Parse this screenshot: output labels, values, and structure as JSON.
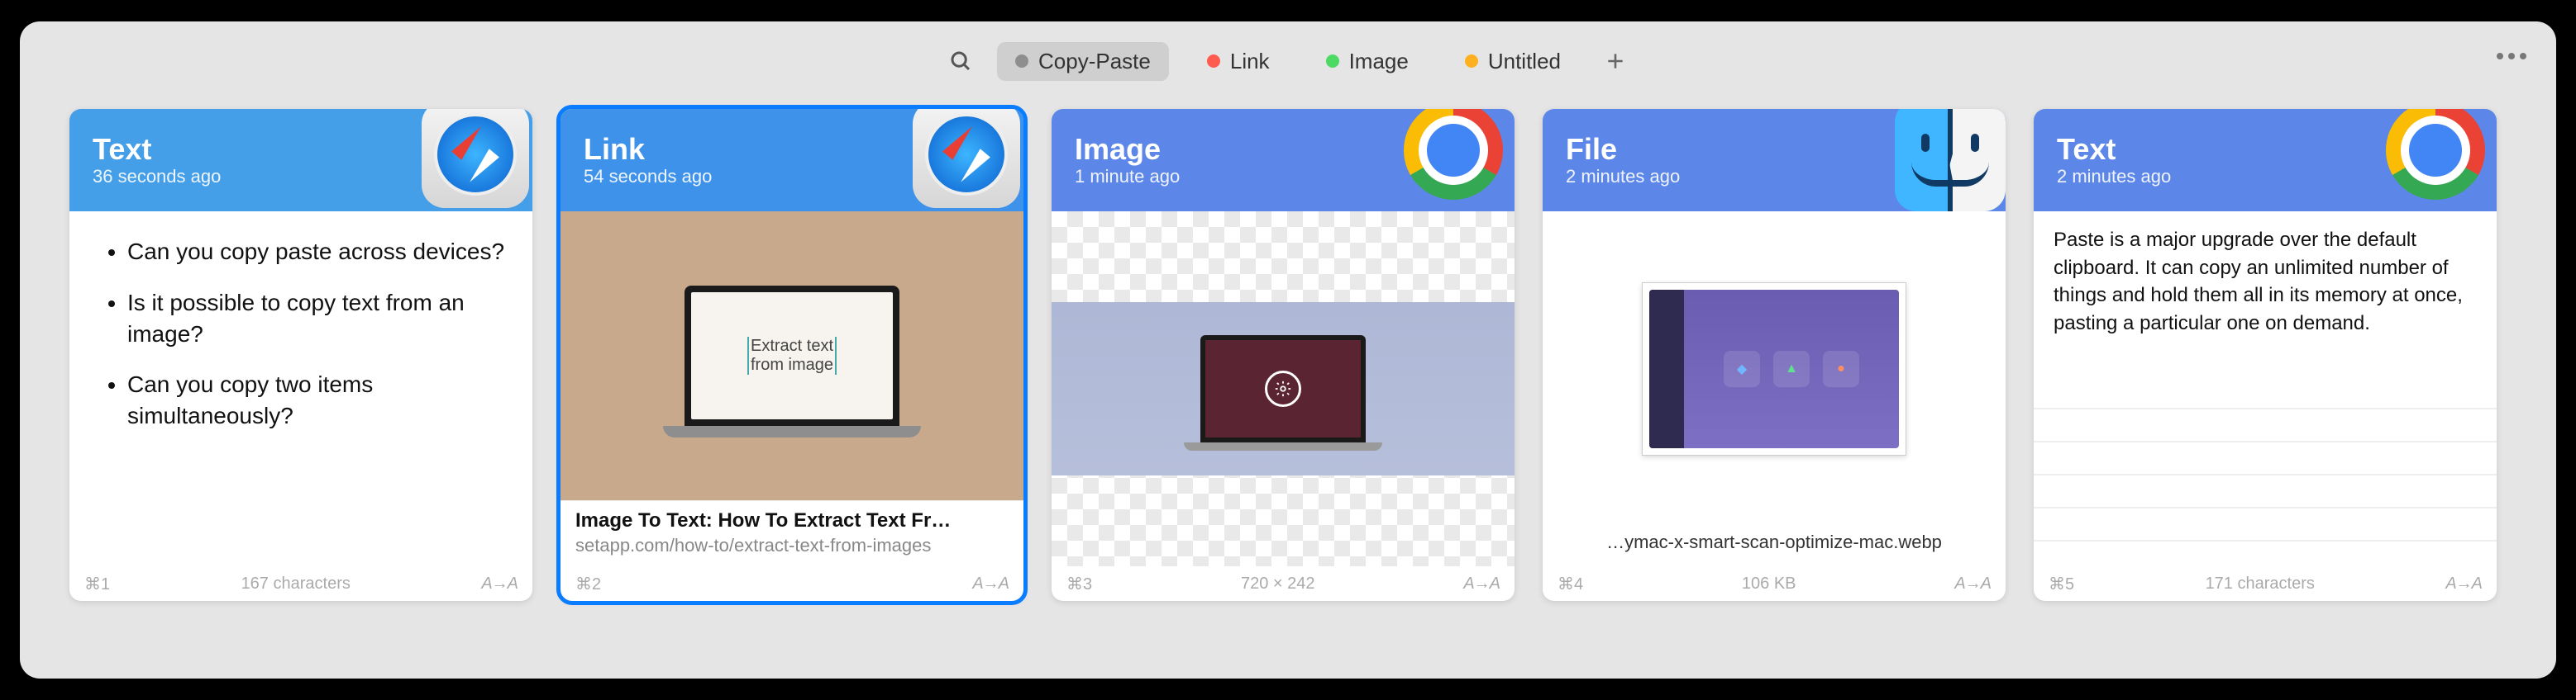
{
  "toolbar": {
    "tags": [
      {
        "label": "Copy-Paste",
        "dot": "#8e8e8e",
        "active": true
      },
      {
        "label": "Link",
        "dot": "#ff5b51",
        "active": false
      },
      {
        "label": "Image",
        "dot": "#4cd964",
        "active": false
      },
      {
        "label": "Untitled",
        "dot": "#ffb020",
        "active": false
      }
    ]
  },
  "transform_label": "A→A",
  "cards": [
    {
      "type": "Text",
      "time": "36 seconds ago",
      "shortcut": "⌘1",
      "meta": "167 characters",
      "bullets": [
        "Can you copy paste across devices?",
        "Is it possible to copy text from an image?",
        "Can you copy two items simultaneously?"
      ]
    },
    {
      "type": "Link",
      "time": "54 seconds ago",
      "shortcut": "⌘2",
      "meta": "",
      "preview_text_1": "Extract text",
      "preview_text_2": "from image",
      "link_title": "Image To Text: How To Extract Text Fr…",
      "link_url": "setapp.com/how-to/extract-text-from-images"
    },
    {
      "type": "Image",
      "time": "1 minute ago",
      "shortcut": "⌘3",
      "meta": "720 × 242"
    },
    {
      "type": "File",
      "time": "2 minutes ago",
      "shortcut": "⌘4",
      "meta": "106 KB",
      "file_name": "…ymac-x-smart-scan-optimize-mac.webp"
    },
    {
      "type": "Text",
      "time": "2 minutes ago",
      "shortcut": "⌘5",
      "meta": "171 characters",
      "paragraph": "Paste is a major upgrade over the default clipboard. It can copy an unlimited number of things and hold them all in its memory at once, pasting a particular one on demand."
    }
  ]
}
